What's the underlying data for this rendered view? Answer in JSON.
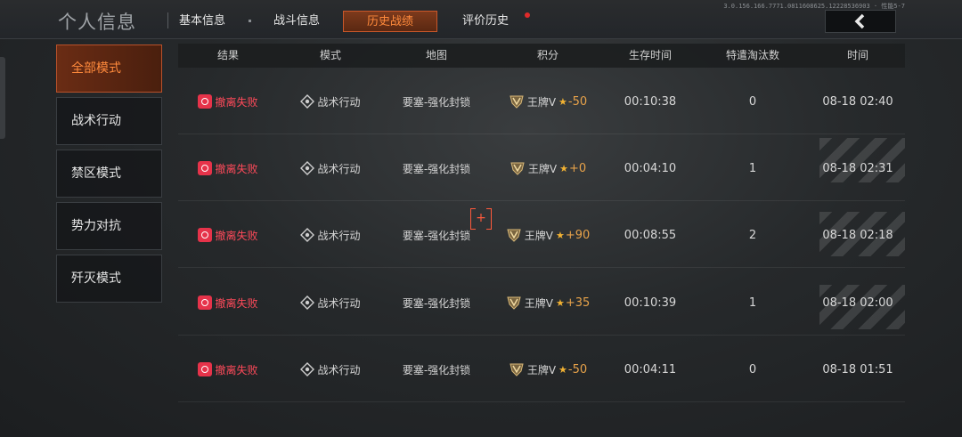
{
  "header": {
    "title": "个人信息",
    "tabs": [
      {
        "label": "基本信息"
      },
      {
        "label": "战斗信息"
      },
      {
        "label": "历史战绩",
        "active": true
      },
      {
        "label": "评价历史",
        "has_notification": true
      }
    ],
    "version_text": "3.0.156.166.7771.0811608625.12228536903 · 性能5-7",
    "back_icon": "chevron-left-icon"
  },
  "sidebar": {
    "items": [
      {
        "label": "全部模式",
        "active": true
      },
      {
        "label": "战术行动"
      },
      {
        "label": "禁区模式"
      },
      {
        "label": "势力对抗"
      },
      {
        "label": "歼灭模式"
      }
    ]
  },
  "table": {
    "columns": [
      "结果",
      "模式",
      "地图",
      "积分",
      "生存时间",
      "特遣淘汰数",
      "时间"
    ],
    "rows": [
      {
        "result": "撤离失败",
        "mode": "战术行动",
        "map": "要塞-强化封锁",
        "rank": "王牌V",
        "delta": "-50",
        "survival": "00:10:38",
        "kills": "0",
        "time": "08-18 02:40"
      },
      {
        "result": "撤离失败",
        "mode": "战术行动",
        "map": "要塞-强化封锁",
        "rank": "王牌V",
        "delta": "+0",
        "survival": "00:04:10",
        "kills": "1",
        "time": "08-18 02:31"
      },
      {
        "result": "撤离失败",
        "mode": "战术行动",
        "map": "要塞-强化封锁",
        "rank": "王牌V",
        "delta": "+90",
        "survival": "00:08:55",
        "kills": "2",
        "time": "08-18 02:18"
      },
      {
        "result": "撤离失败",
        "mode": "战术行动",
        "map": "要塞-强化封锁",
        "rank": "王牌V",
        "delta": "+35",
        "survival": "00:10:39",
        "kills": "1",
        "time": "08-18 02:00"
      },
      {
        "result": "撤离失败",
        "mode": "战术行动",
        "map": "要塞-强化封锁",
        "rank": "王牌V",
        "delta": "-50",
        "survival": "00:04:11",
        "kills": "0",
        "time": "08-18 01:51"
      }
    ]
  },
  "colors": {
    "accent": "#ff8a3c",
    "fail": "#ff4a5a",
    "star": "#f2b233"
  }
}
